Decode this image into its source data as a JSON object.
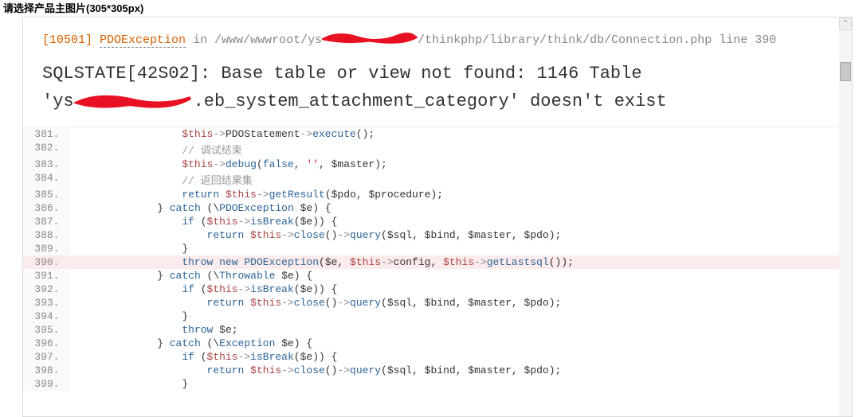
{
  "top_label": "请选择产品主图片(305*305px)",
  "error": {
    "code": "[10501]",
    "class": "PDOException",
    "in": "in",
    "path_pre": "/www/wwwroot/ys",
    "path_post": "/thinkphp/library/think/db/Connection.php",
    "line_label": "line 390"
  },
  "message": {
    "line1": "SQLSTATE[42S02]: Base table or view not found: 1146 Table",
    "line2_pre": "'ys",
    "line2_post": ".eb_system_attachment_category' doesn't exist"
  },
  "code_lines": [
    {
      "n": "381.",
      "indent": "                ",
      "tokens": [
        {
          "t": "this",
          "v": "$this"
        },
        {
          "t": "arrow",
          "v": "->"
        },
        {
          "t": "var",
          "v": "PDOStatement"
        },
        {
          "t": "arrow",
          "v": "->"
        },
        {
          "t": "method",
          "v": "execute"
        },
        {
          "t": "paren",
          "v": "();"
        }
      ]
    },
    {
      "n": "382.",
      "indent": "                ",
      "tokens": [
        {
          "t": "comment",
          "v": "// 调试结束"
        }
      ]
    },
    {
      "n": "383.",
      "indent": "                ",
      "tokens": [
        {
          "t": "this",
          "v": "$this"
        },
        {
          "t": "arrow",
          "v": "->"
        },
        {
          "t": "method",
          "v": "debug"
        },
        {
          "t": "paren",
          "v": "("
        },
        {
          "t": "bool",
          "v": "false"
        },
        {
          "t": "paren",
          "v": ", "
        },
        {
          "t": "str",
          "v": "''"
        },
        {
          "t": "paren",
          "v": ", "
        },
        {
          "t": "var",
          "v": "$master"
        },
        {
          "t": "paren",
          "v": ");"
        }
      ]
    },
    {
      "n": "384.",
      "indent": "                ",
      "tokens": [
        {
          "t": "comment",
          "v": "// 返回结果集"
        }
      ]
    },
    {
      "n": "385.",
      "indent": "                ",
      "tokens": [
        {
          "t": "keyword",
          "v": "return"
        },
        {
          "t": "paren",
          "v": " "
        },
        {
          "t": "this",
          "v": "$this"
        },
        {
          "t": "arrow",
          "v": "->"
        },
        {
          "t": "method",
          "v": "getResult"
        },
        {
          "t": "paren",
          "v": "("
        },
        {
          "t": "var",
          "v": "$pdo"
        },
        {
          "t": "paren",
          "v": ", "
        },
        {
          "t": "var",
          "v": "$procedure"
        },
        {
          "t": "paren",
          "v": ");"
        }
      ]
    },
    {
      "n": "386.",
      "indent": "            ",
      "tokens": [
        {
          "t": "paren",
          "v": "} "
        },
        {
          "t": "keyword",
          "v": "catch"
        },
        {
          "t": "paren",
          "v": " (\\"
        },
        {
          "t": "class",
          "v": "PDOException"
        },
        {
          "t": "paren",
          "v": " "
        },
        {
          "t": "var",
          "v": "$e"
        },
        {
          "t": "paren",
          "v": ") {"
        }
      ]
    },
    {
      "n": "387.",
      "indent": "                ",
      "tokens": [
        {
          "t": "keyword",
          "v": "if"
        },
        {
          "t": "paren",
          "v": " ("
        },
        {
          "t": "this",
          "v": "$this"
        },
        {
          "t": "arrow",
          "v": "->"
        },
        {
          "t": "method",
          "v": "isBreak"
        },
        {
          "t": "paren",
          "v": "("
        },
        {
          "t": "var",
          "v": "$e"
        },
        {
          "t": "paren",
          "v": ")) {"
        }
      ]
    },
    {
      "n": "388.",
      "indent": "                    ",
      "tokens": [
        {
          "t": "keyword",
          "v": "return"
        },
        {
          "t": "paren",
          "v": " "
        },
        {
          "t": "this",
          "v": "$this"
        },
        {
          "t": "arrow",
          "v": "->"
        },
        {
          "t": "method",
          "v": "close"
        },
        {
          "t": "paren",
          "v": "()"
        },
        {
          "t": "arrow",
          "v": "->"
        },
        {
          "t": "method",
          "v": "query"
        },
        {
          "t": "paren",
          "v": "("
        },
        {
          "t": "var",
          "v": "$sql"
        },
        {
          "t": "paren",
          "v": ", "
        },
        {
          "t": "var",
          "v": "$bind"
        },
        {
          "t": "paren",
          "v": ", "
        },
        {
          "t": "var",
          "v": "$master"
        },
        {
          "t": "paren",
          "v": ", "
        },
        {
          "t": "var",
          "v": "$pdo"
        },
        {
          "t": "paren",
          "v": ");"
        }
      ]
    },
    {
      "n": "389.",
      "indent": "                ",
      "tokens": [
        {
          "t": "paren",
          "v": "}"
        }
      ]
    },
    {
      "n": "390.",
      "hl": true,
      "indent": "                ",
      "tokens": [
        {
          "t": "keyword",
          "v": "throw"
        },
        {
          "t": "paren",
          "v": " "
        },
        {
          "t": "keyword2",
          "v": "new"
        },
        {
          "t": "paren",
          "v": " "
        },
        {
          "t": "class",
          "v": "PDOException"
        },
        {
          "t": "paren",
          "v": "("
        },
        {
          "t": "var",
          "v": "$e"
        },
        {
          "t": "paren",
          "v": ", "
        },
        {
          "t": "this",
          "v": "$this"
        },
        {
          "t": "arrow",
          "v": "->"
        },
        {
          "t": "var",
          "v": "config"
        },
        {
          "t": "paren",
          "v": ", "
        },
        {
          "t": "this",
          "v": "$this"
        },
        {
          "t": "arrow",
          "v": "->"
        },
        {
          "t": "method",
          "v": "getLastsql"
        },
        {
          "t": "paren",
          "v": "());"
        }
      ]
    },
    {
      "n": "391.",
      "indent": "            ",
      "tokens": [
        {
          "t": "paren",
          "v": "} "
        },
        {
          "t": "keyword",
          "v": "catch"
        },
        {
          "t": "paren",
          "v": " (\\"
        },
        {
          "t": "class",
          "v": "Throwable"
        },
        {
          "t": "paren",
          "v": " "
        },
        {
          "t": "var",
          "v": "$e"
        },
        {
          "t": "paren",
          "v": ") {"
        }
      ]
    },
    {
      "n": "392.",
      "indent": "                ",
      "tokens": [
        {
          "t": "keyword",
          "v": "if"
        },
        {
          "t": "paren",
          "v": " ("
        },
        {
          "t": "this",
          "v": "$this"
        },
        {
          "t": "arrow",
          "v": "->"
        },
        {
          "t": "method",
          "v": "isBreak"
        },
        {
          "t": "paren",
          "v": "("
        },
        {
          "t": "var",
          "v": "$e"
        },
        {
          "t": "paren",
          "v": ")) {"
        }
      ]
    },
    {
      "n": "393.",
      "indent": "                    ",
      "tokens": [
        {
          "t": "keyword",
          "v": "return"
        },
        {
          "t": "paren",
          "v": " "
        },
        {
          "t": "this",
          "v": "$this"
        },
        {
          "t": "arrow",
          "v": "->"
        },
        {
          "t": "method",
          "v": "close"
        },
        {
          "t": "paren",
          "v": "()"
        },
        {
          "t": "arrow",
          "v": "->"
        },
        {
          "t": "method",
          "v": "query"
        },
        {
          "t": "paren",
          "v": "("
        },
        {
          "t": "var",
          "v": "$sql"
        },
        {
          "t": "paren",
          "v": ", "
        },
        {
          "t": "var",
          "v": "$bind"
        },
        {
          "t": "paren",
          "v": ", "
        },
        {
          "t": "var",
          "v": "$master"
        },
        {
          "t": "paren",
          "v": ", "
        },
        {
          "t": "var",
          "v": "$pdo"
        },
        {
          "t": "paren",
          "v": ");"
        }
      ]
    },
    {
      "n": "394.",
      "indent": "                ",
      "tokens": [
        {
          "t": "paren",
          "v": "}"
        }
      ]
    },
    {
      "n": "395.",
      "indent": "                ",
      "tokens": [
        {
          "t": "keyword",
          "v": "throw"
        },
        {
          "t": "paren",
          "v": " "
        },
        {
          "t": "var",
          "v": "$e"
        },
        {
          "t": "paren",
          "v": ";"
        }
      ]
    },
    {
      "n": "396.",
      "indent": "            ",
      "tokens": [
        {
          "t": "paren",
          "v": "} "
        },
        {
          "t": "keyword",
          "v": "catch"
        },
        {
          "t": "paren",
          "v": " (\\"
        },
        {
          "t": "class",
          "v": "Exception"
        },
        {
          "t": "paren",
          "v": " "
        },
        {
          "t": "var",
          "v": "$e"
        },
        {
          "t": "paren",
          "v": ") {"
        }
      ]
    },
    {
      "n": "397.",
      "indent": "                ",
      "tokens": [
        {
          "t": "keyword",
          "v": "if"
        },
        {
          "t": "paren",
          "v": " ("
        },
        {
          "t": "this",
          "v": "$this"
        },
        {
          "t": "arrow",
          "v": "->"
        },
        {
          "t": "method",
          "v": "isBreak"
        },
        {
          "t": "paren",
          "v": "("
        },
        {
          "t": "var",
          "v": "$e"
        },
        {
          "t": "paren",
          "v": ")) {"
        }
      ]
    },
    {
      "n": "398.",
      "indent": "                    ",
      "tokens": [
        {
          "t": "keyword",
          "v": "return"
        },
        {
          "t": "paren",
          "v": " "
        },
        {
          "t": "this",
          "v": "$this"
        },
        {
          "t": "arrow",
          "v": "->"
        },
        {
          "t": "method",
          "v": "close"
        },
        {
          "t": "paren",
          "v": "()"
        },
        {
          "t": "arrow",
          "v": "->"
        },
        {
          "t": "method",
          "v": "query"
        },
        {
          "t": "paren",
          "v": "("
        },
        {
          "t": "var",
          "v": "$sql"
        },
        {
          "t": "paren",
          "v": ", "
        },
        {
          "t": "var",
          "v": "$bind"
        },
        {
          "t": "paren",
          "v": ", "
        },
        {
          "t": "var",
          "v": "$master"
        },
        {
          "t": "paren",
          "v": ", "
        },
        {
          "t": "var",
          "v": "$pdo"
        },
        {
          "t": "paren",
          "v": ");"
        }
      ]
    },
    {
      "n": "399.",
      "indent": "                ",
      "tokens": [
        {
          "t": "paren",
          "v": "}"
        }
      ]
    }
  ]
}
